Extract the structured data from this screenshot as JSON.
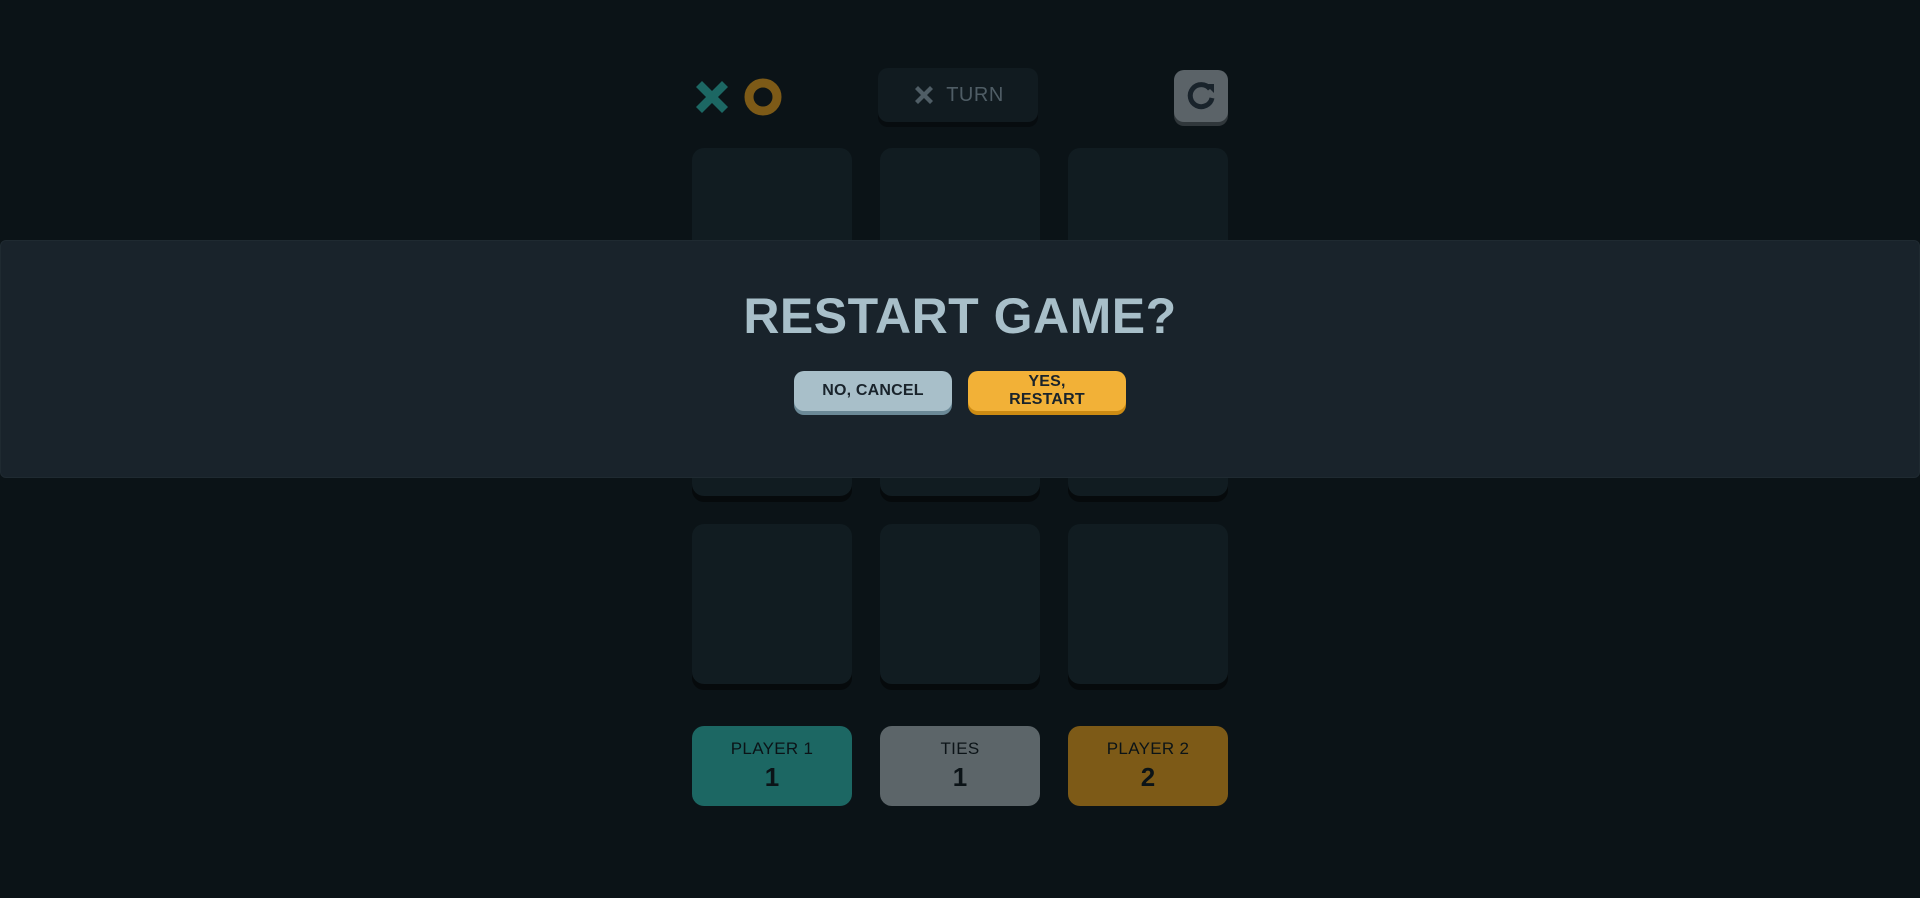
{
  "header": {
    "logo_icons": [
      "x-mark-icon",
      "o-mark-icon"
    ],
    "turn": {
      "icon": "x-mark-icon",
      "label": "TURN"
    },
    "restart_icon": "restart-icon"
  },
  "board": {
    "cells": [
      "",
      "",
      "",
      "",
      "",
      "",
      "",
      "",
      ""
    ]
  },
  "scores": [
    {
      "label": "PLAYER 1",
      "value": "1"
    },
    {
      "label": "TIES",
      "value": "1"
    },
    {
      "label": "PLAYER 2",
      "value": "2"
    }
  ],
  "modal": {
    "title": "RESTART GAME?",
    "cancel_label": "NO, CANCEL",
    "confirm_label": "YES, RESTART"
  },
  "colors": {
    "background": "#0b1317",
    "x_color": "#1c6763",
    "o_color": "#7d5a17",
    "silver": "#a8bfc9",
    "yellow": "#f2b137"
  }
}
